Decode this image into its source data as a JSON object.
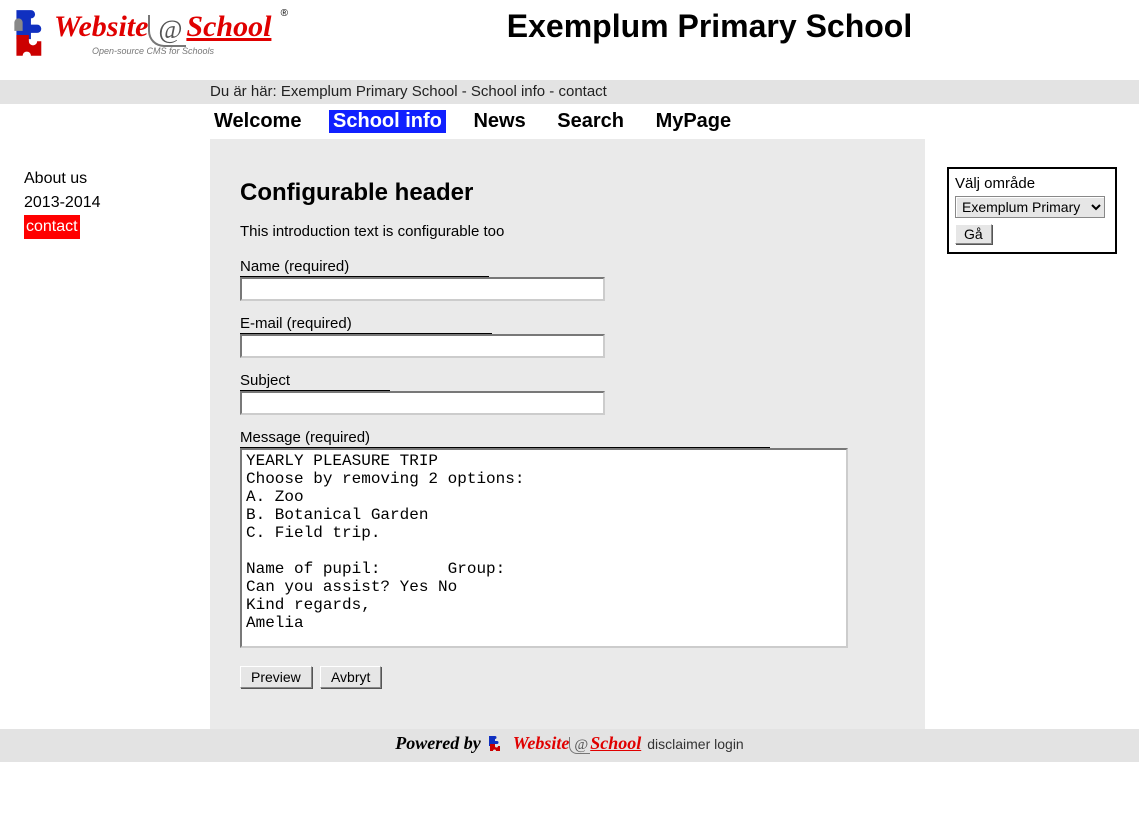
{
  "logo": {
    "word1": "Website",
    "at": "@",
    "word2": "School",
    "sub": "Open-source CMS for Schools",
    "reg": "®"
  },
  "site_title": "Exemplum Primary School",
  "breadcrumb": {
    "prefix": "Du är här: ",
    "path": "Exemplum Primary School - School info - contact"
  },
  "nav": {
    "items": [
      {
        "label": "Welcome",
        "active": false
      },
      {
        "label": "School info",
        "active": true
      },
      {
        "label": "News",
        "active": false
      },
      {
        "label": "Search",
        "active": false
      },
      {
        "label": "MyPage",
        "active": false
      }
    ]
  },
  "sidebar": {
    "items": [
      {
        "label": "About us",
        "active": false
      },
      {
        "label": "2013-2014",
        "active": false
      },
      {
        "label": "contact",
        "active": true
      }
    ]
  },
  "content": {
    "header": "Configurable header",
    "intro": "This introduction text is configurable too",
    "labels": {
      "name": "Name (required)",
      "email": "E-mail (required)",
      "subject": "Subject",
      "message": "Message (required)"
    },
    "values": {
      "name": "",
      "email": "",
      "subject": "",
      "message": "YEARLY PLEASURE TRIP\nChoose by removing 2 options:\nA. Zoo\nB. Botanical Garden\nC. Field trip.\n\nName of pupil:       Group:\nCan you assist? Yes No\nKind regards,\nAmelia"
    },
    "buttons": {
      "preview": "Preview",
      "cancel": "Avbryt"
    }
  },
  "area_select": {
    "label": "Välj område",
    "option": "Exemplum Primary",
    "go": "Gå"
  },
  "footer": {
    "powered": "Powered by",
    "logo_word1": "Website",
    "logo_at": "@",
    "logo_word2": "School",
    "links": {
      "disclaimer": "disclaimer",
      "login": "login"
    }
  }
}
